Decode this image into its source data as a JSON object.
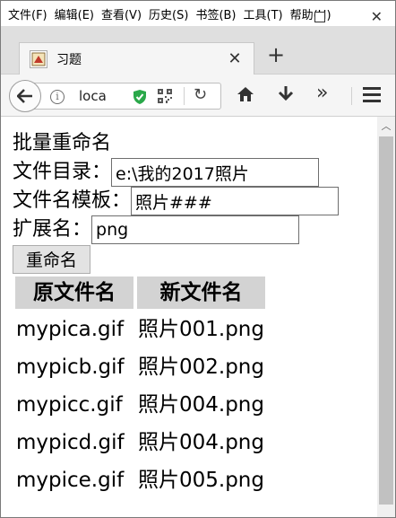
{
  "menubar": {
    "items": [
      "文件(F)",
      "编辑(E)",
      "查看(V)",
      "历史(S)",
      "书签(B)",
      "工具(T)",
      "帮助(H)"
    ]
  },
  "tab": {
    "title": "习题",
    "favicon": "puzzle-favicon"
  },
  "navbar": {
    "url": "loca"
  },
  "page": {
    "heading": "批量重命名",
    "dir_label": "文件目录：",
    "dir_value": "e:\\我的2017照片",
    "template_label": "文件名模板：",
    "template_value": "照片###",
    "ext_label": "扩展名：",
    "ext_value": "png",
    "rename_button": "重命名"
  },
  "table": {
    "headers": [
      "原文件名",
      "新文件名"
    ],
    "rows": [
      [
        "mypica.gif",
        "照片001.png"
      ],
      [
        "mypicb.gif",
        "照片002.png"
      ],
      [
        "mypicc.gif",
        "照片004.png"
      ],
      [
        "mypicd.gif",
        "照片004.png"
      ],
      [
        "mypice.gif",
        "照片005.png"
      ]
    ]
  }
}
